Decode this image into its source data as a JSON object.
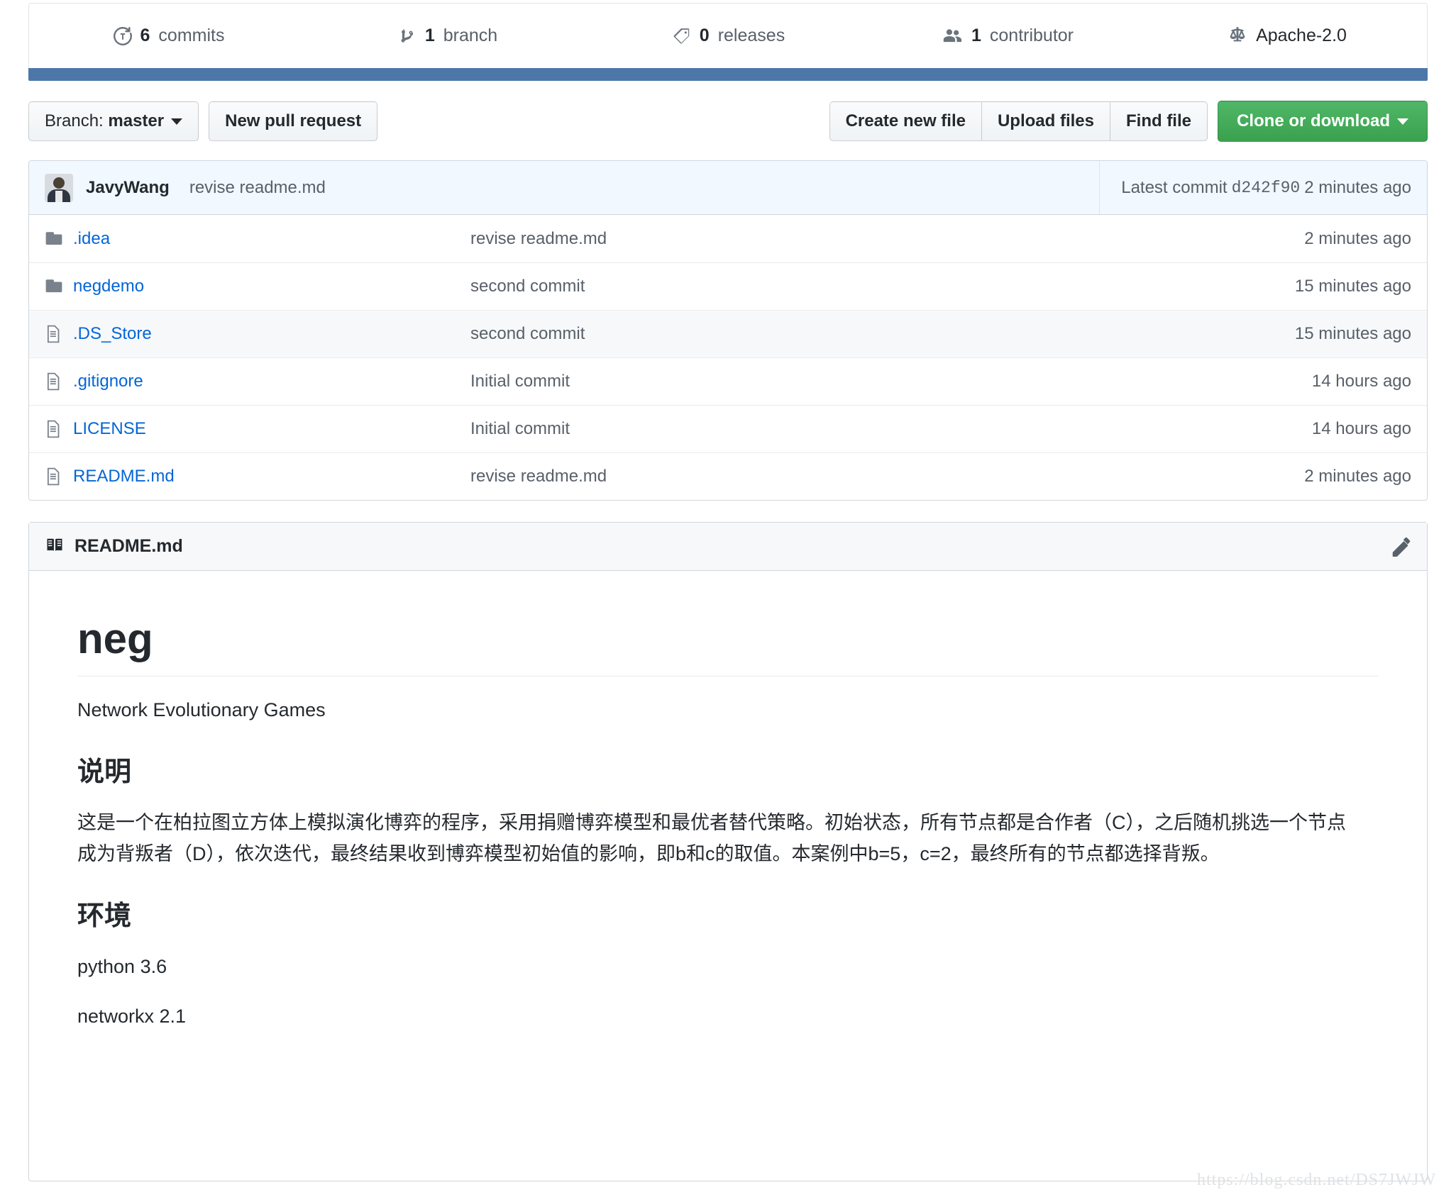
{
  "stats": [
    {
      "icon": "history-icon",
      "num": "6",
      "label": "commits"
    },
    {
      "icon": "branch-icon",
      "num": "1",
      "label": "branch"
    },
    {
      "icon": "tag-icon",
      "num": "0",
      "label": "releases"
    },
    {
      "icon": "people-icon",
      "num": "1",
      "label": "contributor"
    },
    {
      "icon": "law-icon",
      "num": "",
      "label": "Apache-2.0"
    }
  ],
  "toolbar": {
    "branch_prefix": "Branch:",
    "branch_name": "master",
    "new_pull_request": "New pull request",
    "create_new_file": "Create new file",
    "upload_files": "Upload files",
    "find_file": "Find file",
    "clone_or_download": "Clone or download"
  },
  "commit_bar": {
    "author": "JavyWang",
    "message": "revise readme.md",
    "latest_label": "Latest commit",
    "sha": "d242f90",
    "age": "2 minutes ago"
  },
  "files": [
    {
      "type": "folder",
      "name": ".idea",
      "message": "revise readme.md",
      "age": "2 minutes ago",
      "hovered": false
    },
    {
      "type": "folder",
      "name": "negdemo",
      "message": "second commit",
      "age": "15 minutes ago",
      "hovered": false
    },
    {
      "type": "file",
      "name": ".DS_Store",
      "message": "second commit",
      "age": "15 minutes ago",
      "hovered": true
    },
    {
      "type": "file",
      "name": ".gitignore",
      "message": "Initial commit",
      "age": "14 hours ago",
      "hovered": false
    },
    {
      "type": "file",
      "name": "LICENSE",
      "message": "Initial commit",
      "age": "14 hours ago",
      "hovered": false
    },
    {
      "type": "file",
      "name": "README.md",
      "message": "revise readme.md",
      "age": "2 minutes ago",
      "hovered": false
    }
  ],
  "readme": {
    "header_title": "README.md",
    "header_icon": "book-icon",
    "edit_icon": "pencil-icon",
    "h1": "neg",
    "subtitle": "Network Evolutionary Games",
    "section1_heading": "说明",
    "section1_body": "这是一个在柏拉图立方体上模拟演化博弈的程序，采用捐赠博弈模型和最优者替代策略。初始状态，所有节点都是合作者（C），之后随机挑选一个节点成为背叛者（D），依次迭代，最终结果收到博弈模型初始值的影响，即b和c的取值。本案例中b=5，c=2，最终所有的节点都选择背叛。",
    "section2_heading": "环境",
    "section2_line1": "python 3.6",
    "section2_line2": "networkx 2.1"
  },
  "watermark": "https://blog.csdn.net/DS7JWJW",
  "colors": {
    "link": "#0366d6",
    "green_button": "#3aa14e",
    "blue_bar": "#4c77a8",
    "muted_text": "#586069"
  }
}
